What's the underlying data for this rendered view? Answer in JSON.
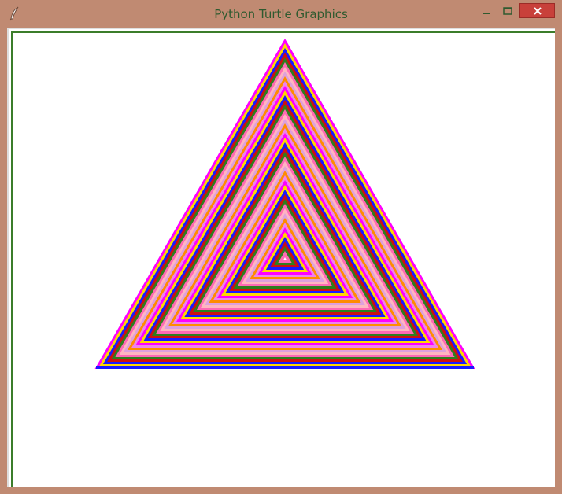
{
  "window": {
    "title": "Python Turtle Graphics"
  },
  "icons": {
    "app": "feather-icon",
    "minimize": "minimize-icon",
    "maximize": "maximize-icon",
    "close": "close-icon"
  },
  "colors": {
    "frame": "#c08a72",
    "title_text": "#2f5a2f",
    "close_button": "#c8403a",
    "canvas_background": "#ffffff",
    "canvas_border": "#3b7d2a"
  },
  "drawing": {
    "shape": "nested-triangles",
    "pen_colors": [
      "#ff00ff",
      "#ffd700",
      "#1a1aff",
      "#cc1111",
      "#2e7d1e",
      "#ff69b4",
      "#ffb6c1",
      "#dda0dd",
      "#ff8c00",
      "#ee82ee"
    ]
  }
}
